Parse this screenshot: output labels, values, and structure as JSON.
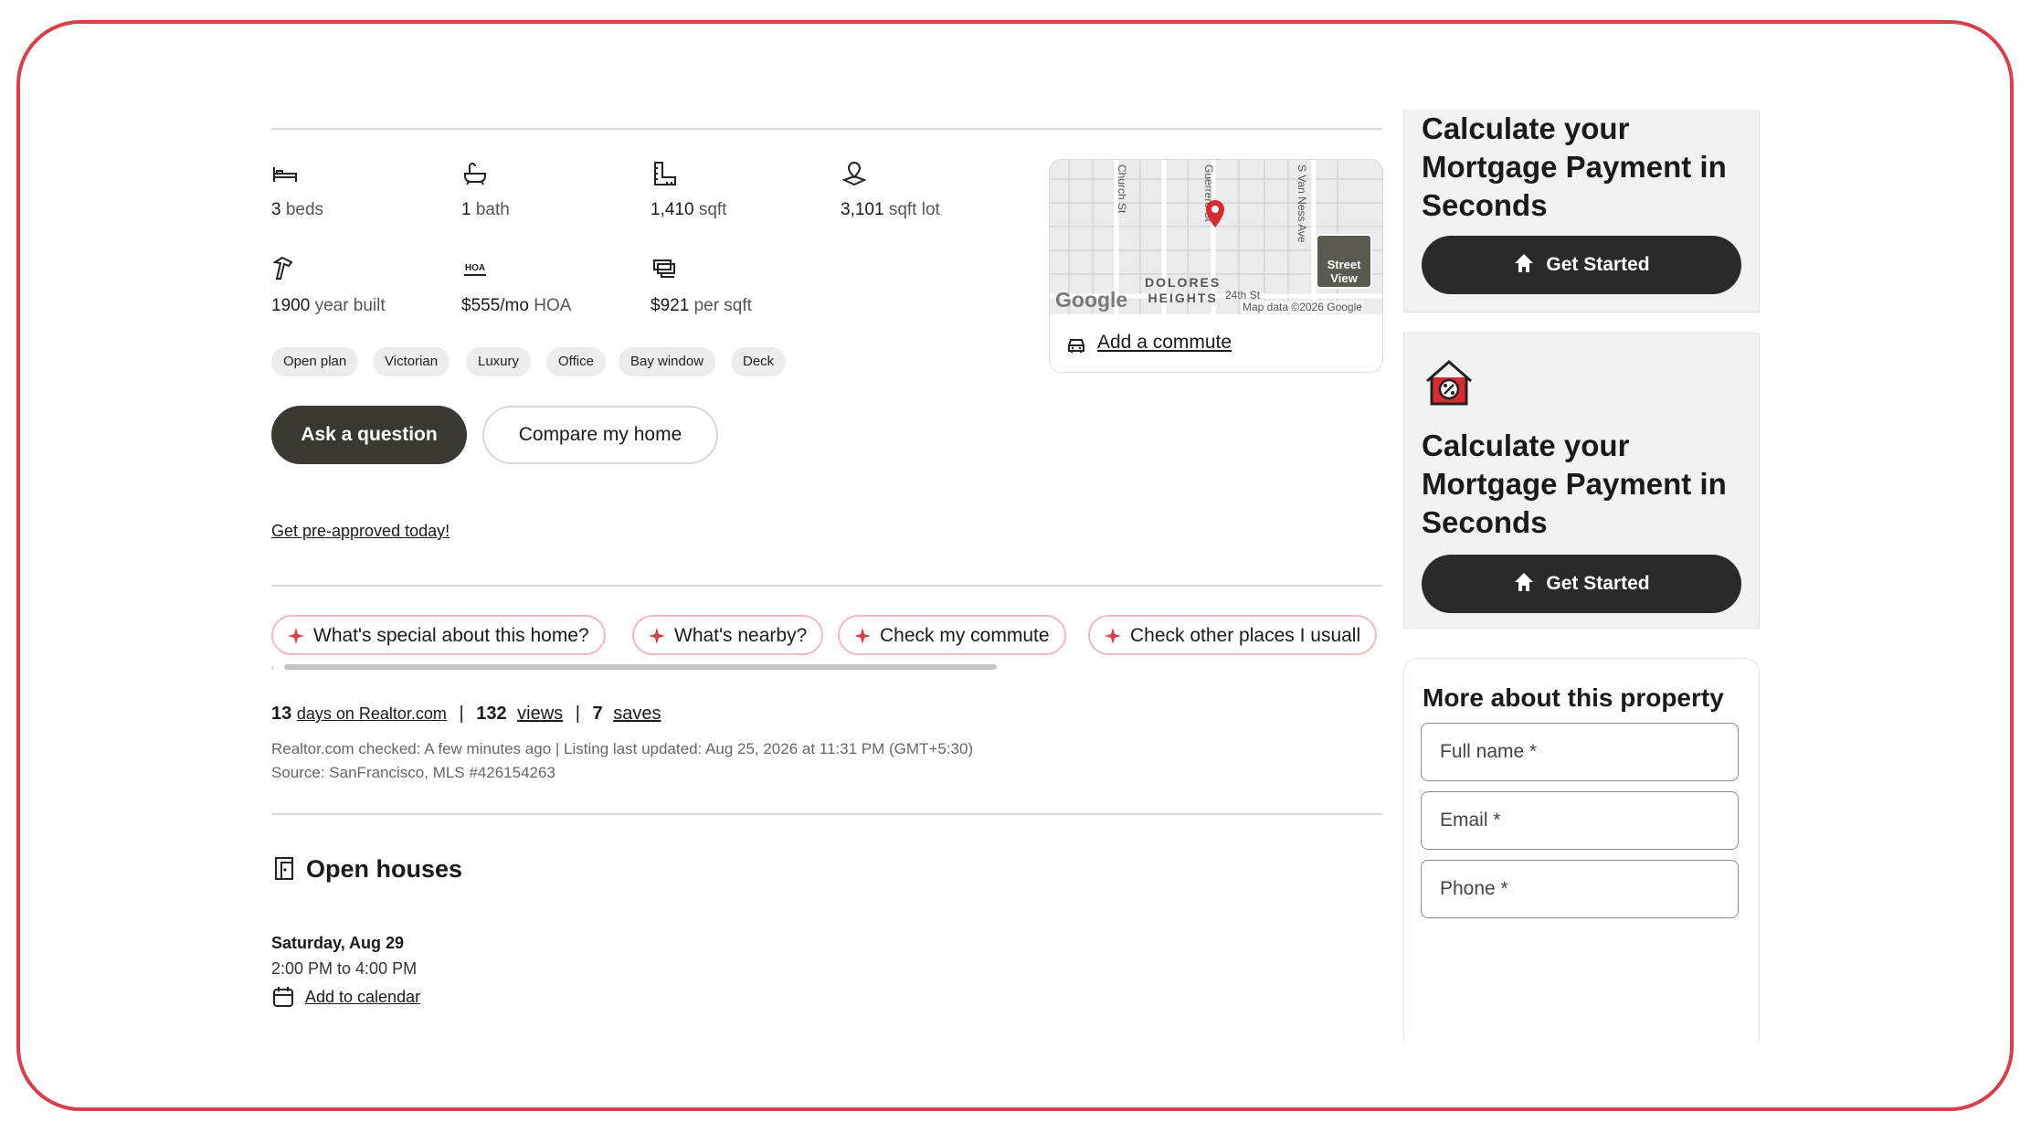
{
  "facts": {
    "beds": {
      "value": "3",
      "unit": "beds"
    },
    "bath": {
      "value": "1",
      "unit": "bath"
    },
    "sqft": {
      "value": "1,410",
      "unit": "sqft"
    },
    "lot": {
      "value": "3,101",
      "unit": "sqft lot"
    },
    "year": {
      "value": "1900",
      "unit": "year built"
    },
    "hoa": {
      "value": "$555/mo",
      "unit": "HOA"
    },
    "per_sqft": {
      "value": "$921",
      "unit": "per sqft"
    },
    "hoa_icon_label": "HOA"
  },
  "tags": [
    "Open plan",
    "Victorian",
    "Luxury",
    "Office",
    "Bay window",
    "Deck"
  ],
  "buttons": {
    "ask": "Ask a question",
    "compare": "Compare my home"
  },
  "preapproved_link": "Get pre-approved today!",
  "chips": [
    "What's special about this home?",
    "What's nearby?",
    "Check my commute",
    "Check other places I usuall"
  ],
  "stats": {
    "days": "13",
    "days_label": "days on Realtor.com",
    "views": "132",
    "views_label": "views",
    "saves": "7",
    "saves_label": "saves",
    "separator": "|"
  },
  "listing_info": {
    "checked": "Realtor.com checked: A few minutes ago | Listing last updated: Aug 25, 2026 at 11:31 PM (GMT+5:30)",
    "source": "Source: SanFrancisco, MLS #426154263"
  },
  "open_houses": {
    "title": "Open houses",
    "date": "Saturday, Aug 29",
    "time": "2:00 PM to 4:00 PM",
    "calendar_link": "Add to calendar"
  },
  "map": {
    "streets": [
      "Church St",
      "Guerrero St",
      "S Van Ness Ave",
      "24th St"
    ],
    "neighborhood_line1": "DOLORES",
    "neighborhood_line2": "HEIGHTS",
    "street_view_line1": "Street",
    "street_view_line2": "View",
    "google": "Google",
    "attribution": "Map data ©2026 Google",
    "commute_link": "Add a commute"
  },
  "mortgage_cards": [
    {
      "title_lines": [
        "Calculate your",
        "Mortgage Payment in",
        "Seconds"
      ],
      "button": "Get Started"
    },
    {
      "title_lines": [
        "Calculate your",
        "Mortgage Payment in",
        "Seconds"
      ],
      "button": "Get Started"
    }
  ],
  "contact_form": {
    "title": "More about this property",
    "full_name": "Full name *",
    "email": "Email *",
    "phone": "Phone *"
  },
  "colors": {
    "accent": "#d6404a",
    "dark_button": "#3b3732",
    "card_button": "#2a2a2a",
    "chip_border": "#f0b9bc"
  }
}
